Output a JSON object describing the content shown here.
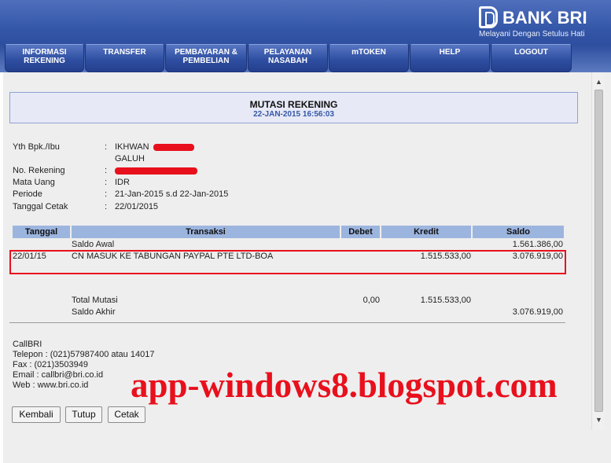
{
  "brand": {
    "name": "BANK BRI",
    "tagline": "Melayani Dengan Setulus Hati"
  },
  "nav": {
    "tabs": [
      {
        "label": "INFORMASI\nREKENING"
      },
      {
        "label": "TRANSFER"
      },
      {
        "label": "PEMBAYARAN &\nPEMBELIAN"
      },
      {
        "label": "PELAYANAN\nNASABAH"
      },
      {
        "label": "mTOKEN"
      },
      {
        "label": "HELP"
      },
      {
        "label": "LOGOUT"
      }
    ]
  },
  "page": {
    "title": "MUTASI REKENING",
    "datetime": "22-JAN-2015 16:56:03"
  },
  "account": {
    "name_label": "Yth Bpk./Ibu",
    "name_line1": "IKHWAN",
    "name_line2": "GALUH",
    "number_label": "No. Rekening",
    "currency_label": "Mata Uang",
    "currency": "IDR",
    "period_label": "Periode",
    "period": "21-Jan-2015 s.d 22-Jan-2015",
    "print_date_label": "Tanggal Cetak",
    "print_date": "22/01/2015",
    "separator": ":"
  },
  "table": {
    "headers": {
      "date": "Tanggal",
      "transaction": "Transaksi",
      "debit": "Debet",
      "credit": "Kredit",
      "balance": "Saldo"
    },
    "opening": {
      "label": "Saldo Awal",
      "balance": "1.561.386,00"
    },
    "rows": [
      {
        "date": "22/01/15",
        "description": "CN MASUK KE TABUNGAN PAYPAL PTE LTD-BOA",
        "credit": "1.515.533,00",
        "balance": "3.076.919,00"
      }
    ],
    "totals": {
      "label": "Total Mutasi",
      "debit": "0,00",
      "credit": "1.515.533,00"
    },
    "closing": {
      "label": "Saldo Akhir",
      "balance": "3.076.919,00"
    }
  },
  "contact": {
    "title": "CallBRI",
    "phone": "Telepon : (021)57987400 atau 14017",
    "fax": "Fax : (021)3503949",
    "email": "Email : callbri@bri.co.id",
    "web": "Web : www.bri.co.id"
  },
  "buttons": {
    "back": "Kembali",
    "close": "Tutup",
    "print": "Cetak"
  },
  "watermark": "app-windows8.blogspot.com",
  "colors": {
    "header_blue": "#3557a8",
    "table_header": "#9cb5df",
    "highlight_red": "#e8101c",
    "title_box": "#e7e9f6"
  },
  "icons": {
    "logo": "bri-logo-icon",
    "scroll_up": "scroll-up-arrow-icon",
    "scroll_down": "scroll-down-arrow-icon"
  }
}
